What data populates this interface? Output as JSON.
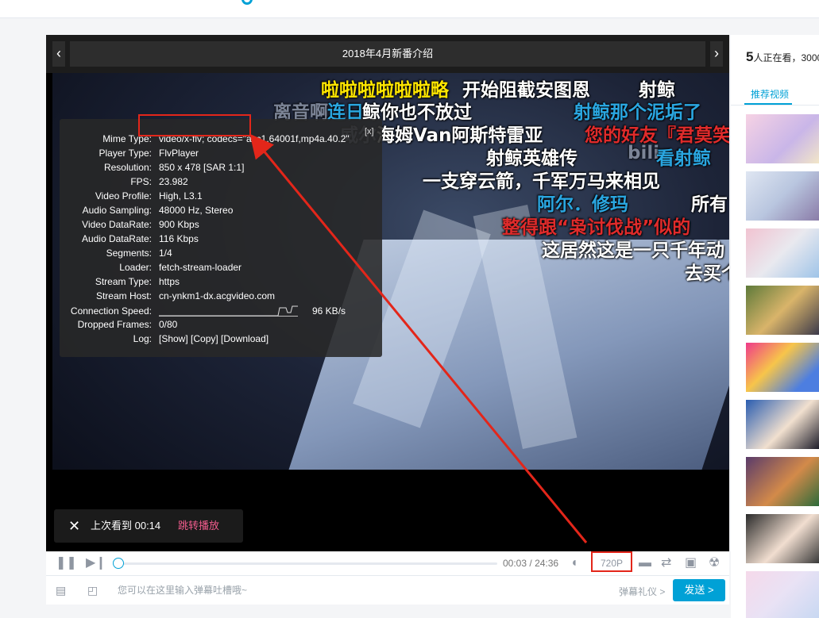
{
  "player": {
    "title": "2018年4月新番介绍",
    "prev_icon": "chevron-left-icon",
    "next_icon": "chevron-right-icon"
  },
  "danmaku": [
    {
      "text": "啦啦啦啦啦啦略",
      "color": "y"
    },
    {
      "text": "开始阻截安图恩",
      "color": "w"
    },
    {
      "text": "射鲸",
      "color": "w"
    },
    {
      "text": "离音啊",
      "color": "ghost"
    },
    {
      "text": "连日",
      "color": "b"
    },
    {
      "text": "鲸你也不放过",
      "color": "w"
    },
    {
      "text": "射鲸那个泥垢了",
      "color": "b"
    },
    {
      "text": "威尔",
      "color": "ghost"
    },
    {
      "text": "海姆Van阿斯特雷亚",
      "color": "w"
    },
    {
      "text": "您的好友『君莫笑",
      "color": "r"
    },
    {
      "text": "射鲸英雄传",
      "color": "w"
    },
    {
      "text": "bili",
      "color": "ghost"
    },
    {
      "text": "看射鲸",
      "color": "b"
    },
    {
      "text": "一支穿云箭，千军万马来相见",
      "color": "w"
    },
    {
      "text": "阿尔．修玛",
      "color": "b"
    },
    {
      "text": "所有",
      "color": "w"
    },
    {
      "text": "整得跟“枭讨伐战”似的",
      "color": "r"
    },
    {
      "text": "这居然这是一只千年动",
      "color": "w"
    },
    {
      "text": "去买个",
      "color": "w"
    }
  ],
  "stats": {
    "close_label": "[x]",
    "rows": [
      {
        "k": "Mime Type:",
        "v": "video/x-flv; codecs=\"avc1.64001f,mp4a.40.2\""
      },
      {
        "k": "Player Type:",
        "v": "FlvPlayer"
      },
      {
        "k": "Resolution:",
        "v": "850 x 478 [SAR 1:1]"
      },
      {
        "k": "FPS:",
        "v": "23.982"
      },
      {
        "k": "Video Profile:",
        "v": "High, L3.1"
      },
      {
        "k": "Audio Sampling:",
        "v": "48000 Hz, Stereo"
      },
      {
        "k": "Video DataRate:",
        "v": "900 Kbps"
      },
      {
        "k": "Audio DataRate:",
        "v": "116 Kbps"
      },
      {
        "k": "Segments:",
        "v": "1/4"
      },
      {
        "k": "Loader:",
        "v": "fetch-stream-loader"
      },
      {
        "k": "Stream Type:",
        "v": "https"
      },
      {
        "k": "Stream Host:",
        "v": "cn-ynkm1-dx.acgvideo.com"
      }
    ],
    "connection_speed_label": "Connection Speed:",
    "connection_speed_value": "96 KB/s",
    "dropped_frames_label": "Dropped Frames:",
    "dropped_frames_value": "0/80",
    "log_label": "Log:",
    "log_value": "[Show] [Copy] [Download]"
  },
  "resume": {
    "close_icon": "close-icon",
    "text": "上次看到 00:14",
    "jump_label": "跳转播放"
  },
  "controls": {
    "play_pause_icon": "pause-icon",
    "next_icon": "skip-next-icon",
    "current_time": "00:03",
    "separator": "/",
    "total_time": "24:36",
    "progress": 0.002,
    "volume_icon": "volume-icon",
    "quality": "720P",
    "danmaku_toggle_icon": "danmaku-icon",
    "loop_icon": "loop-icon",
    "tv_icon": "tv-icon",
    "settings_icon": "radiation-icon"
  },
  "danmaku_bar": {
    "danmaku_list_icon": "comment-icon",
    "window_icon": "window-icon",
    "placeholder": "您可以在这里输入弹幕吐槽哦~",
    "etiquette": "弹幕礼仪 >",
    "send_label": "发送 >"
  },
  "sidebar": {
    "viewers_count": "5",
    "viewers_text": "人正在看，3000",
    "tab_label": "推荐视频"
  },
  "colors": {
    "accent": "#00a1d6",
    "highlight": "#e3261a",
    "jump": "#f25d8e"
  }
}
